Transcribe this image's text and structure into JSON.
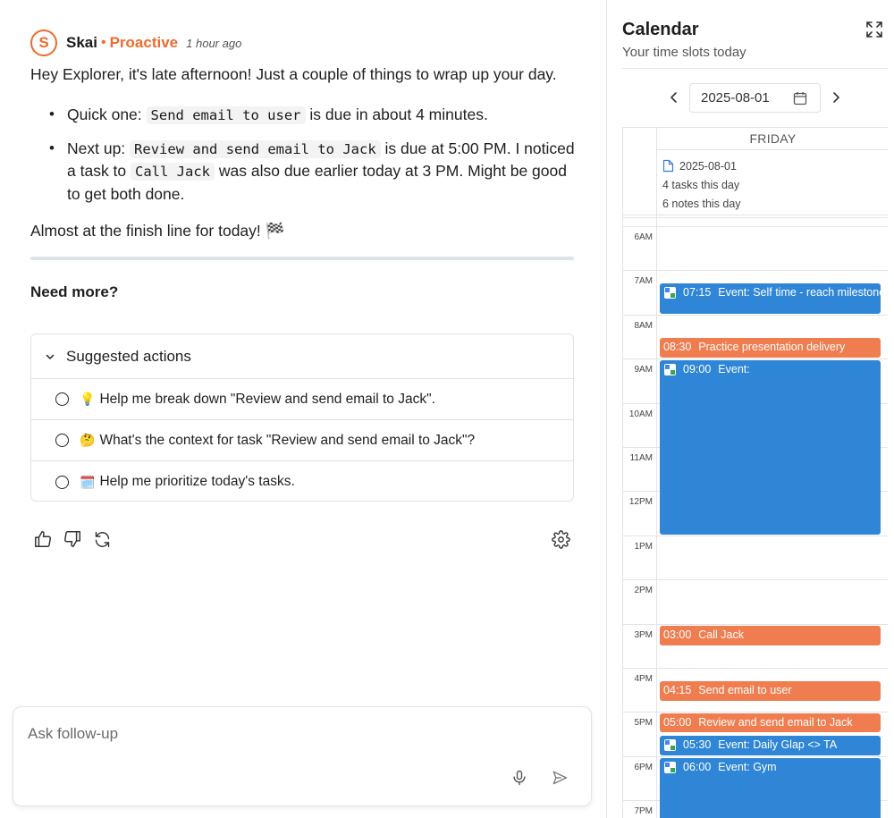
{
  "chat": {
    "agent_initial": "S",
    "agent_name": "Skai",
    "separator": "•",
    "agent_mode": "Proactive",
    "time_ago": "1 hour ago",
    "greeting": "Hey Explorer, it's late afternoon! Just a couple of things to wrap up your day.",
    "bullet1": {
      "prefix": "Quick one: ",
      "code": "Send email to user",
      "suffix": " is due in about 4 minutes."
    },
    "bullet2": {
      "prefix": "Next up: ",
      "code1": "Review and send email to Jack",
      "middle": " is due at 5:00 PM. I noticed a task to ",
      "code2": "Call Jack",
      "suffix": " was also due earlier today at 3 PM. Might be good to get both done."
    },
    "finish_text": "Almost at the finish line for today! 🏁",
    "need_more": "Need more?",
    "suggested_title": "Suggested actions",
    "suggestions": [
      {
        "emoji": "💡",
        "text": "Help me break down \"Review and send email to Jack\"."
      },
      {
        "emoji": "🤔",
        "text": "What's the context for task \"Review and send email to Jack\"?"
      },
      {
        "emoji": "🗓️",
        "text": "Help me prioritize today's tasks."
      }
    ],
    "input_placeholder": "Ask follow-up"
  },
  "calendar": {
    "title": "Calendar",
    "subtitle": "Your time slots today",
    "date_value": "2025-08-01",
    "day_header": "FRIDAY",
    "allday_date": "2025-08-01",
    "tasks_count": "4 tasks this day",
    "notes_count": "6 notes this day",
    "hours": [
      "6AM",
      "7AM",
      "8AM",
      "9AM",
      "10AM",
      "11AM",
      "12PM",
      "1PM",
      "2PM",
      "3PM",
      "4PM",
      "5PM",
      "6PM",
      "7PM"
    ],
    "events": [
      {
        "time": "07:15",
        "label": "Event: Self time - reach milestone",
        "type": "google",
        "color": "#2f86d6"
      },
      {
        "time": "08:30",
        "label": "Practice presentation delivery",
        "type": "task",
        "color": "#f07d4f"
      },
      {
        "time": "09:00",
        "label": "Event:",
        "type": "google",
        "color": "#2f86d6"
      },
      {
        "time": "03:00",
        "label": "Call Jack",
        "type": "task",
        "color": "#f07d4f"
      },
      {
        "time": "04:15",
        "label": "Send email to user",
        "type": "task",
        "color": "#f07d4f"
      },
      {
        "time": "05:00",
        "label": "Review and send email to Jack",
        "type": "task",
        "color": "#f07d4f"
      },
      {
        "time": "05:30",
        "label": "Event: Daily Glap <> TA",
        "type": "google",
        "color": "#2f86d6"
      },
      {
        "time": "06:00",
        "label": "Event: Gym",
        "type": "google",
        "color": "#2f86d6"
      }
    ]
  }
}
